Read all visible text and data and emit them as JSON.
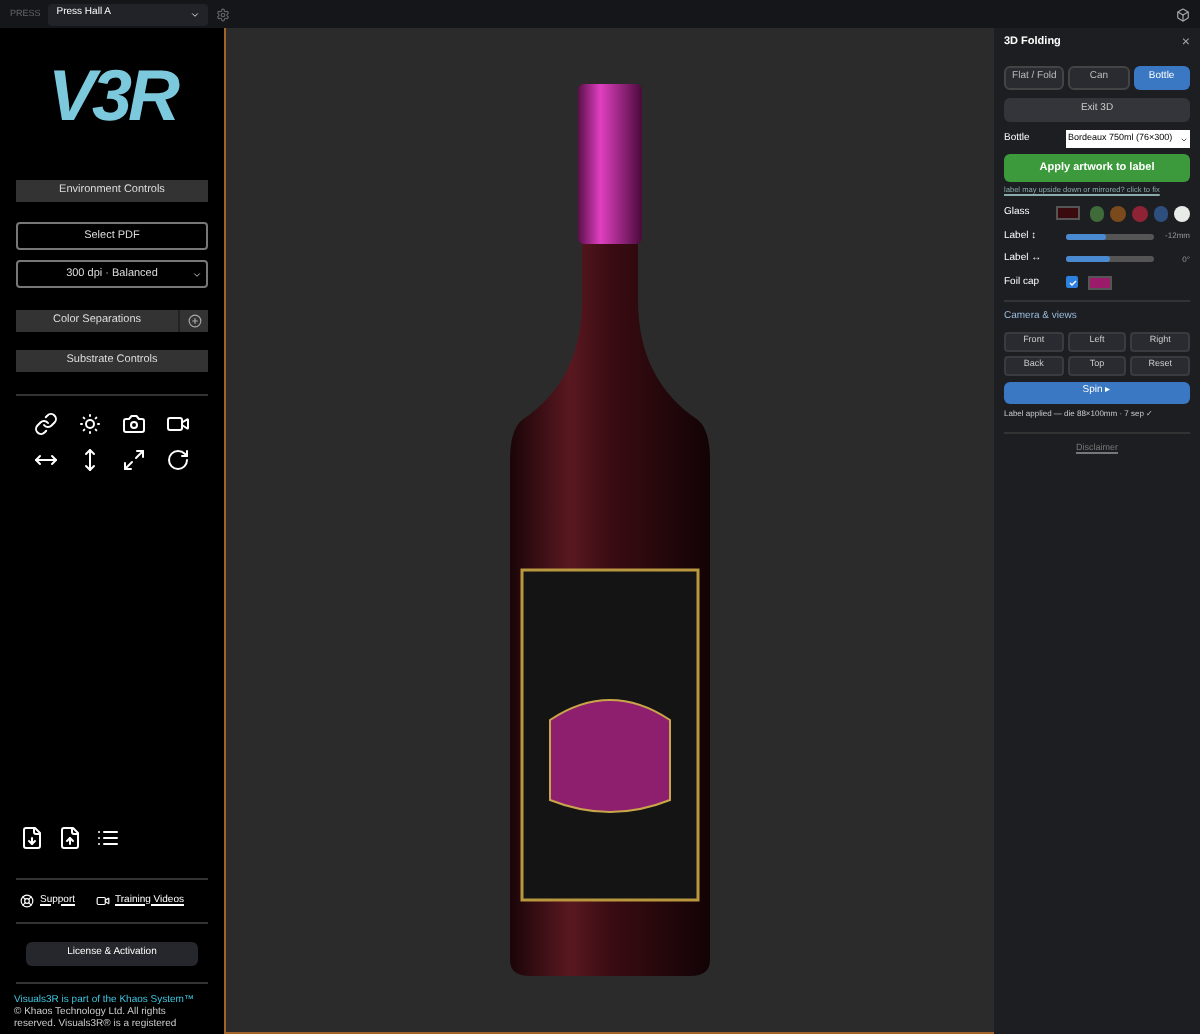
{
  "topbar": {
    "press_label": "PRESS",
    "press_value": "Press Hall A"
  },
  "sidebar": {
    "logo": "V3R",
    "buttons": [
      {
        "label": "Environment Controls",
        "kind": "plain"
      },
      {
        "label": "Select PDF",
        "kind": "outline"
      },
      {
        "label": "300 dpi · Balanced",
        "kind": "select"
      },
      {
        "label": "Color Separations",
        "kind": "expand"
      },
      {
        "label": "Substrate Controls",
        "kind": "plain"
      }
    ],
    "links": [
      {
        "label": "Support",
        "kind": "support"
      },
      {
        "label": "Training Videos",
        "kind": "video"
      }
    ],
    "license": "License & Activation",
    "footer_title": "Visuals3R is part of the Khaos System™",
    "footer_text": "© Khaos Technology Ltd. All rights reserved. Visuals3R® is a registered"
  },
  "panel": {
    "title": "3D Folding",
    "close": "×",
    "tabs": [
      {
        "label": "Flat / Fold",
        "selected": false
      },
      {
        "label": "Can",
        "selected": false
      },
      {
        "label": "Bottle",
        "selected": true
      }
    ],
    "exit": "Exit 3D",
    "bottle_label": "Bottle",
    "bottle_value": "Bordeaux 750ml (76×300)",
    "apply": "Apply artwork to label",
    "fix_link": "label may upside down or mirrored? click to fix",
    "glass_label": "Glass",
    "glass_swatches": [
      {
        "kind": "custom",
        "color": "#3a0a0e"
      },
      {
        "kind": "preset",
        "color": "#3f6b3a"
      },
      {
        "kind": "preset",
        "color": "#7a4a1c"
      },
      {
        "kind": "preset",
        "color": "#8e2335"
      },
      {
        "kind": "preset",
        "color": "#2e4f7e"
      },
      {
        "kind": "preset",
        "color": "#e8ece8"
      }
    ],
    "sliders": [
      {
        "label": "Label ↕",
        "level": 0.45,
        "reading": "-12mm"
      },
      {
        "label": "Label ↔",
        "level": 0.5,
        "reading": "0°"
      }
    ],
    "foil_label": "Foil cap",
    "foil_checked": true,
    "foil_swatches": [
      {
        "kind": "custom",
        "color": "#9b1a6a"
      }
    ],
    "camera_title": "Camera & views",
    "views": [
      "Front",
      "Left",
      "Right",
      "Back",
      "Top",
      "Reset"
    ],
    "spin": "Spin ▸",
    "status": "Label applied — die 88×100mm · 7 sep ✓",
    "disclaimer": "Disclaimer"
  }
}
